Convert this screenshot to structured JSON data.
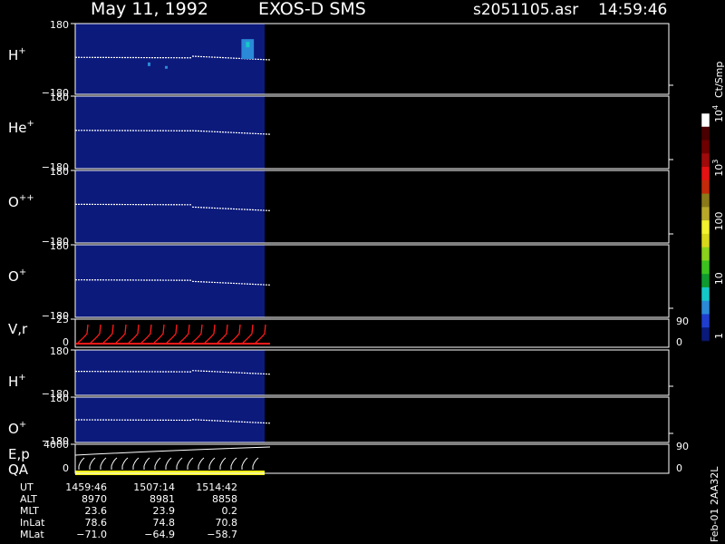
{
  "header": {
    "date": "May 11, 1992",
    "instrument": "EXOS-D SMS",
    "file": "s2051105.asr",
    "time": "14:59:46"
  },
  "colorbar": {
    "unit_label": "Ct/Smp",
    "tick_labels": [
      "1",
      "10",
      "100",
      "10",
      "10"
    ],
    "tick_exponents": [
      "",
      "",
      "",
      "3",
      "4"
    ],
    "tick_values": [
      1,
      10,
      100,
      1000,
      10000
    ],
    "colors": [
      "#0a1a7a",
      "#1f3ed0",
      "#2a8ad8",
      "#15c8c8",
      "#0f9a30",
      "#3cc21f",
      "#8ad21c",
      "#d8d81a",
      "#f2f22e",
      "#b8a82a",
      "#8a7a1a",
      "#c22a0a",
      "#e41212",
      "#a00a0a",
      "#6e0000",
      "#4a0000",
      "#ffffff"
    ]
  },
  "chart_data": [
    {
      "type": "heatmap",
      "panel": "H+",
      "label_main": "H",
      "label_sup": "+",
      "y_ticks": [
        "180",
        "−180"
      ],
      "ylim": [
        -180,
        180
      ],
      "trace_y": [
        8,
        0
      ],
      "blob": [
        [
          0.28,
          0.22,
          0.035,
          0.28
        ]
      ]
    },
    {
      "type": "heatmap",
      "panel": "He+",
      "label_main": "He",
      "label_sup": "+",
      "y_ticks": [
        "180",
        "−180"
      ],
      "ylim": [
        -180,
        180
      ],
      "trace_y": [
        10,
        -5
      ]
    },
    {
      "type": "heatmap",
      "panel": "O++",
      "label_main": "O",
      "label_sup": "++",
      "y_ticks": [
        "180",
        "−180"
      ],
      "ylim": [
        -180,
        180
      ],
      "trace_y": [
        12,
        -15
      ]
    },
    {
      "type": "heatmap",
      "panel": "O+",
      "label_main": "O",
      "label_sup": "+",
      "y_ticks": [
        "180",
        "−180"
      ],
      "ylim": [
        -180,
        180
      ],
      "trace_y": [
        6,
        -15
      ]
    },
    {
      "type": "line",
      "panel": "V,r",
      "label_main": "V,r",
      "label_sup": "",
      "y_ticks": [
        "25",
        "0"
      ],
      "right_ticks": [
        "90",
        "0"
      ],
      "ylim": [
        0,
        25
      ]
    },
    {
      "type": "heatmap",
      "panel": "H+ (2)",
      "label_main": "H",
      "label_sup": "+",
      "y_ticks": [
        "180",
        "−180"
      ],
      "ylim": [
        -180,
        180
      ],
      "trace_y": [
        10,
        -5
      ]
    },
    {
      "type": "heatmap",
      "panel": "O+ (2)",
      "label_main": "O",
      "label_sup": "+",
      "y_ticks": [
        "180",
        "−180"
      ],
      "ylim": [
        -180,
        180
      ],
      "trace_y": [
        0,
        -20
      ]
    },
    {
      "type": "line",
      "panel": "E,p",
      "label_main": "E,p",
      "label_sup": "",
      "label2": "QA",
      "y_ticks": [
        "4000",
        "0"
      ],
      "right_ticks": [
        "90",
        "0"
      ],
      "ylim": [
        0,
        4000
      ]
    }
  ],
  "ephemeris": {
    "rows": [
      {
        "label": "UT",
        "values": [
          "1459:46",
          "1507:14",
          "1514:42"
        ]
      },
      {
        "label": "ALT",
        "values": [
          "8970",
          "8981",
          "8858"
        ]
      },
      {
        "label": "MLT",
        "values": [
          "23.6",
          "23.9",
          "0.2"
        ]
      },
      {
        "label": "InLat",
        "values": [
          "78.6",
          "74.8",
          "70.8"
        ]
      },
      {
        "label": "MLat",
        "values": [
          "−71.0",
          "−64.9",
          "−58.7"
        ]
      }
    ]
  },
  "version_label": "Feb-01 2AA32L"
}
